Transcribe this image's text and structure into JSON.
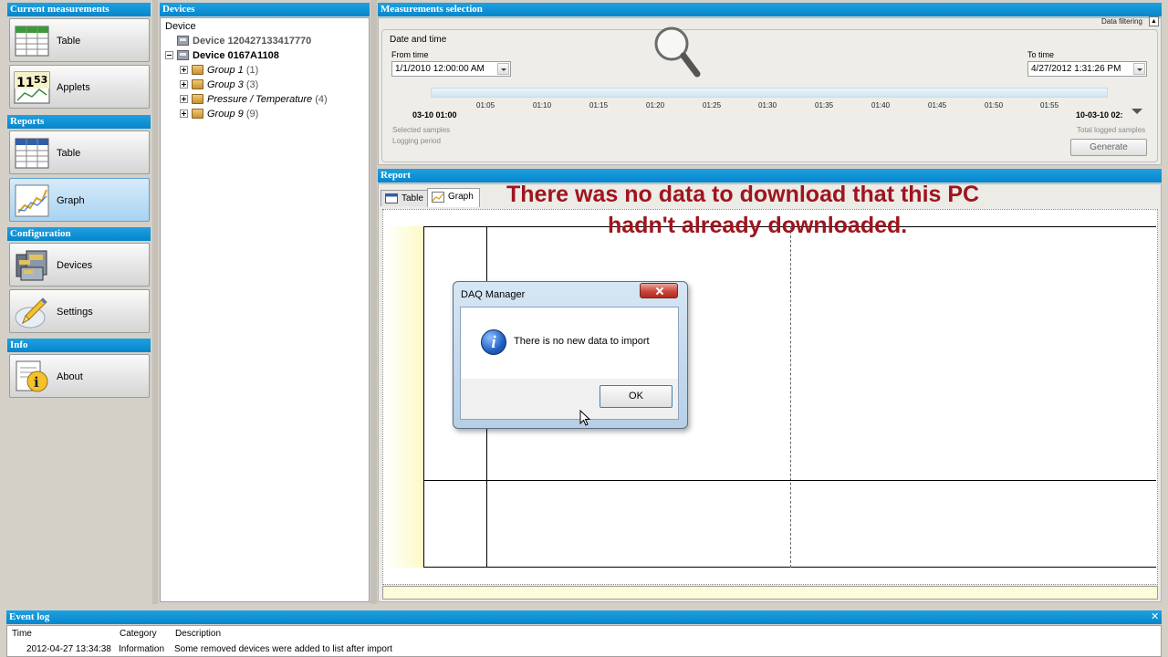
{
  "sidebar": {
    "sections": {
      "current": "Current measurements",
      "reports": "Reports",
      "configuration": "Configuration",
      "info": "Info"
    },
    "buttons": {
      "current_table": "Table",
      "applets": "Applets",
      "reports_table": "Table",
      "graph": "Graph",
      "devices": "Devices",
      "settings": "Settings",
      "about": "About"
    },
    "applet_icon_digits": {
      "hours": "11",
      "minutes": "53"
    }
  },
  "devices_panel": {
    "title": "Devices",
    "column": "Device",
    "device1": "Device 120427133417770",
    "device2": "Device 0167A1108",
    "groups": [
      {
        "name": "Group 1",
        "count": "(1)"
      },
      {
        "name": "Group 3",
        "count": "(3)"
      },
      {
        "name": "Pressure / Temperature",
        "count": "(4)"
      },
      {
        "name": "Group 9",
        "count": "(9)"
      }
    ]
  },
  "measurements": {
    "title": "Measurements selection",
    "data_filtering": "Data filtering",
    "date_and_time": "Date and time",
    "from_label": "From time",
    "from_value": "1/1/2010 12:00:00 AM",
    "to_label": "To time",
    "to_value": "4/27/2012 1:31:26 PM",
    "timeline_start": "03-10 01:00",
    "timeline_end": "10-03-10 02:",
    "ticks": [
      "01:05",
      "01:10",
      "01:15",
      "01:20",
      "01:25",
      "01:30",
      "01:35",
      "01:40",
      "01:45",
      "01:50",
      "01:55"
    ],
    "selected_samples": "Selected samples",
    "logging_period": "Logging period",
    "total_logged": "Total logged samples",
    "generate": "Generate"
  },
  "report": {
    "title": "Report",
    "tab_table": "Table",
    "tab_graph": "Graph"
  },
  "overlay": {
    "line1": "There was no data to download that this PC",
    "line2": "hadn't already downloaded."
  },
  "dialog": {
    "title": "DAQ Manager",
    "message": "There is no new data to import",
    "ok": "OK"
  },
  "event_log": {
    "title": "Event log",
    "col_time": "Time",
    "col_category": "Category",
    "col_description": "Description",
    "rows": [
      {
        "time": "2012-04-27 13:34:38",
        "category": "Information",
        "description": "Some removed devices were added to list after import"
      }
    ]
  },
  "colors": {
    "header_blue": "#0686cc",
    "overlay_red": "#a0141e"
  },
  "icons": [
    "table-icon",
    "applet-clock-icon",
    "graph-icon",
    "devices-icon",
    "settings-pencil-icon",
    "about-info-icon",
    "magnifier-icon",
    "info-icon",
    "close-icon"
  ]
}
